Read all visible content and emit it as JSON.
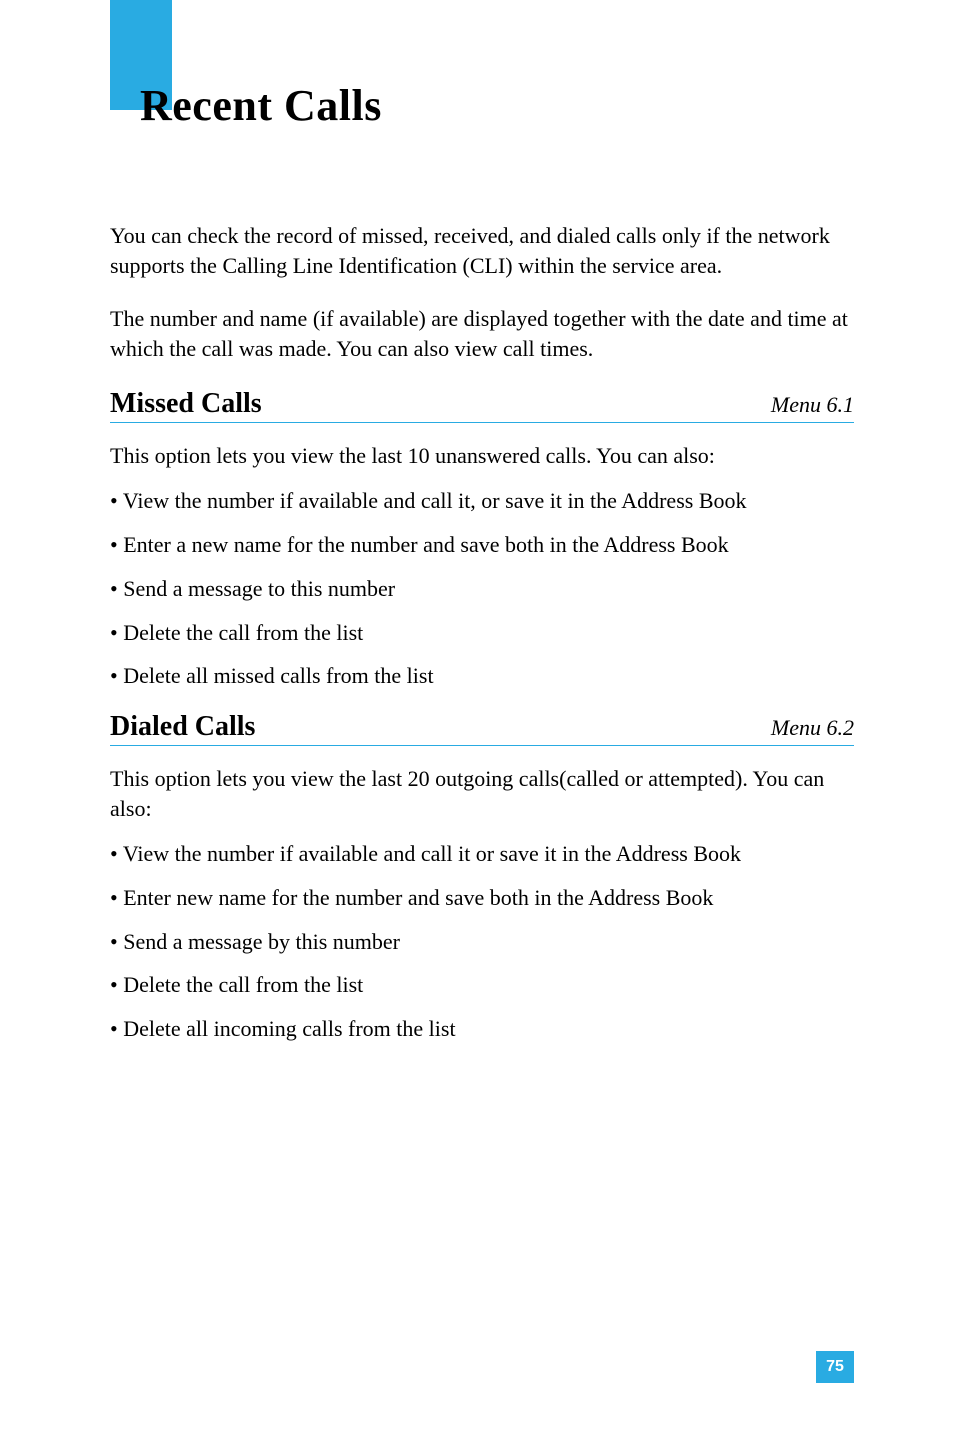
{
  "title": "Recent Calls",
  "intro_paragraphs": [
    "You can check the record of missed, received, and dialed calls only if the network supports the Calling Line Identification (CLI) within the service area.",
    "The number and name (if available) are displayed together with the date and time at which the call was made. You can also view call times."
  ],
  "sections": [
    {
      "title": "Missed Calls",
      "menu": "Menu 6.1",
      "intro": "This option lets you view the last 10 unanswered calls. You can also:",
      "bullets": [
        "View the number if available and call it, or save it in the Address Book",
        "Enter a new name for the number and save both in the Address Book",
        "Send a message to this number",
        "Delete the call from the list",
        "Delete all missed calls from the list"
      ]
    },
    {
      "title": "Dialed Calls",
      "menu": "Menu 6.2",
      "intro": "This option lets you view the last 20 outgoing calls(called or attempted). You can also:",
      "bullets": [
        "View the number if available and call it or save it in the Address Book",
        "Enter new name for the number and save both in the Address Book",
        "Send a message by this number",
        "Delete the call from the list",
        "Delete all incoming calls from the list"
      ]
    }
  ],
  "page_number": "75"
}
